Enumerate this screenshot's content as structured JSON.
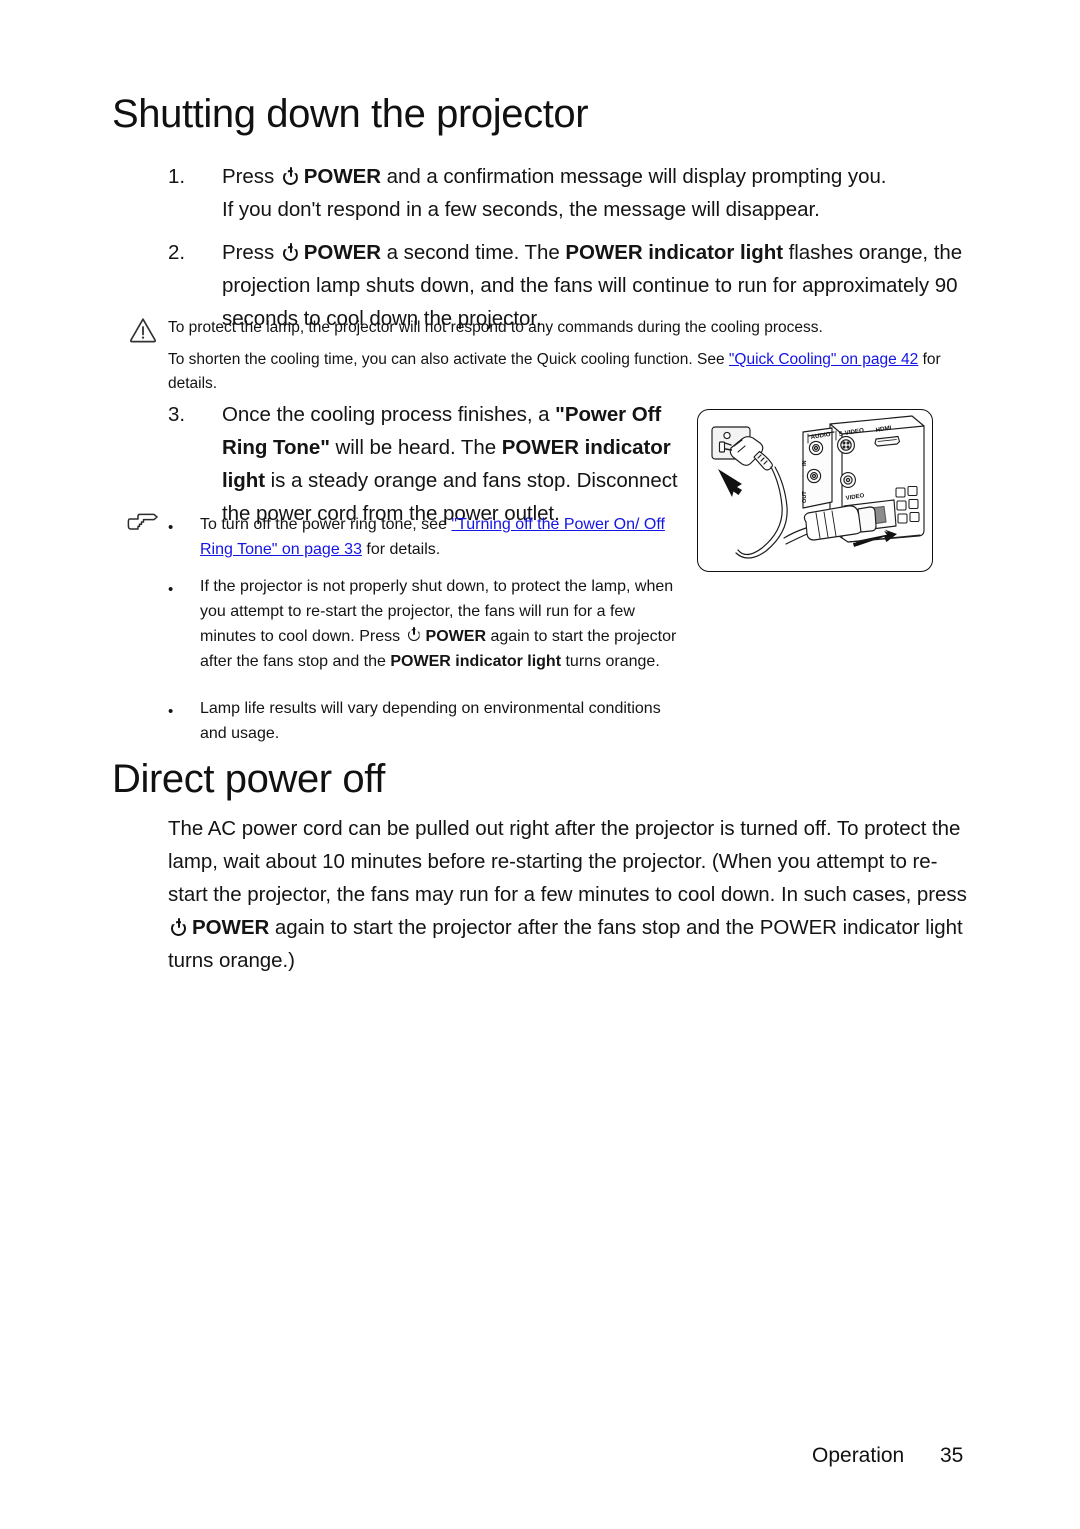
{
  "document": {
    "heading_shutdown": "Shutting down the projector",
    "heading_direct": "Direct power off"
  },
  "steps": [
    {
      "number": "1.",
      "line1_pre": "Press ",
      "power_label": "POWER",
      "line1_post": " and a confirmation message will display prompting you.",
      "line2": "If you don't respond in a few seconds, the message will disappear."
    },
    {
      "number": "2.",
      "pre": "Press ",
      "power_label": "POWER",
      "mid": " a second time. The ",
      "bold_phrase": "POWER indicator light",
      "post": " flashes orange, the projection lamp shuts down, and the fans will continue to run for approximately 90 seconds to cool down the projector."
    },
    {
      "number": "3.",
      "pre": "Once the cooling process finishes, a ",
      "bold1": "\"Power Off Ring Tone\"",
      "mid1": " will be heard. The ",
      "bold2": "POWER indicator light",
      "post": " is a steady orange and fans stop. Disconnect the power cord from the power outlet."
    }
  ],
  "warning_note": {
    "icon": "warning-triangle-icon",
    "line1": "To protect the lamp, the projector will not respond to any commands during the cooling process.",
    "line2_pre": "To shorten the cooling time, you can also activate the Quick cooling function. See ",
    "line2_link": "\"Quick Cooling\" on page 42",
    "line2_post": " for details."
  },
  "tip_notes": {
    "icon": "pointing-hand-icon",
    "items": [
      {
        "pre": "To turn off the power ring tone, see ",
        "link": "\"Turning off the Power On/ Off Ring Tone\" on page 33",
        "post": " for details."
      },
      {
        "pre": "If the projector is not properly shut down, to protect the lamp, when you attempt to re-start the projector, the fans will run for a few minutes to cool down. Press ",
        "power_label": "POWER",
        "mid": " again to start the projector after the fans stop and the ",
        "bold": "POWER indicator light",
        "post": " turns orange."
      },
      {
        "pre": "Lamp life results will vary depending on environmental conditions and usage.",
        "link": "",
        "post": ""
      }
    ]
  },
  "direct_power_off": {
    "part1": "The AC power cord can be pulled out right after the projector is turned off. To protect the lamp, wait about 10 minutes before re-starting the projector. (When you attempt to re-start the projector, the fans may run for a few minutes to cool down. In such cases, press ",
    "power_label": "POWER",
    "part2": " again to start the projector after the fans stop and the POWER indicator light turns orange.)"
  },
  "illustration": {
    "name": "power-cord-disconnect-diagram",
    "port_labels": [
      "AUDIO",
      "S-VIDEO",
      "HDMI",
      "IN",
      "OUT",
      "VIDEO"
    ]
  },
  "footer": {
    "label": "Operation",
    "page_number": "35"
  },
  "colors": {
    "link": "#1414e6",
    "text": "#141414"
  }
}
